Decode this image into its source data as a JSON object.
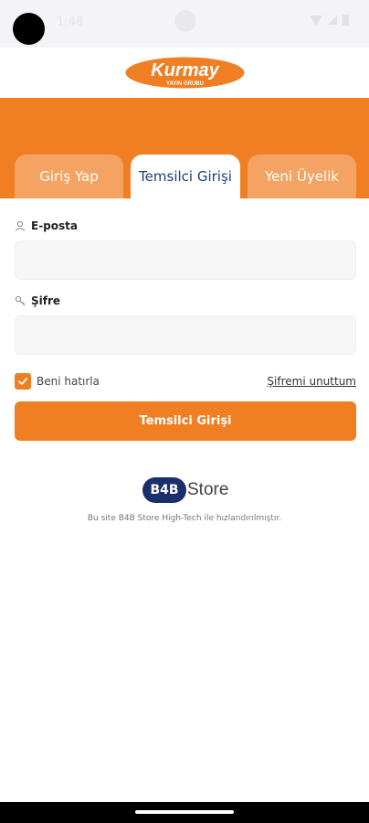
{
  "status_bar": {
    "time": "1:48"
  },
  "brand": {
    "logo_name": "Kurmay",
    "logo_subtitle": "YAYIN GRUBU"
  },
  "tabs": [
    {
      "label": "Giriş Yap",
      "active": false
    },
    {
      "label": "Temsilci Girişi",
      "active": true
    },
    {
      "label": "Yeni Üyelik",
      "active": false
    }
  ],
  "form": {
    "email_label": "E-posta",
    "email_value": "",
    "password_label": "Şifre",
    "password_value": "",
    "remember_label": "Beni hatırla",
    "remember_checked": true,
    "forgot_label": "Şifremi unuttum",
    "submit_label": "Temsilci Girişi"
  },
  "footer": {
    "brand_badge": "B4B",
    "brand_word": "Store",
    "powered_by": "Bu site B4B Store High-Tech ile hızlandırılmıştır."
  },
  "colors": {
    "accent": "#f07f24",
    "tab_inactive": "#f4a363",
    "brand_navy": "#1a2f6c",
    "tab_active_text": "#1f3d7a"
  }
}
